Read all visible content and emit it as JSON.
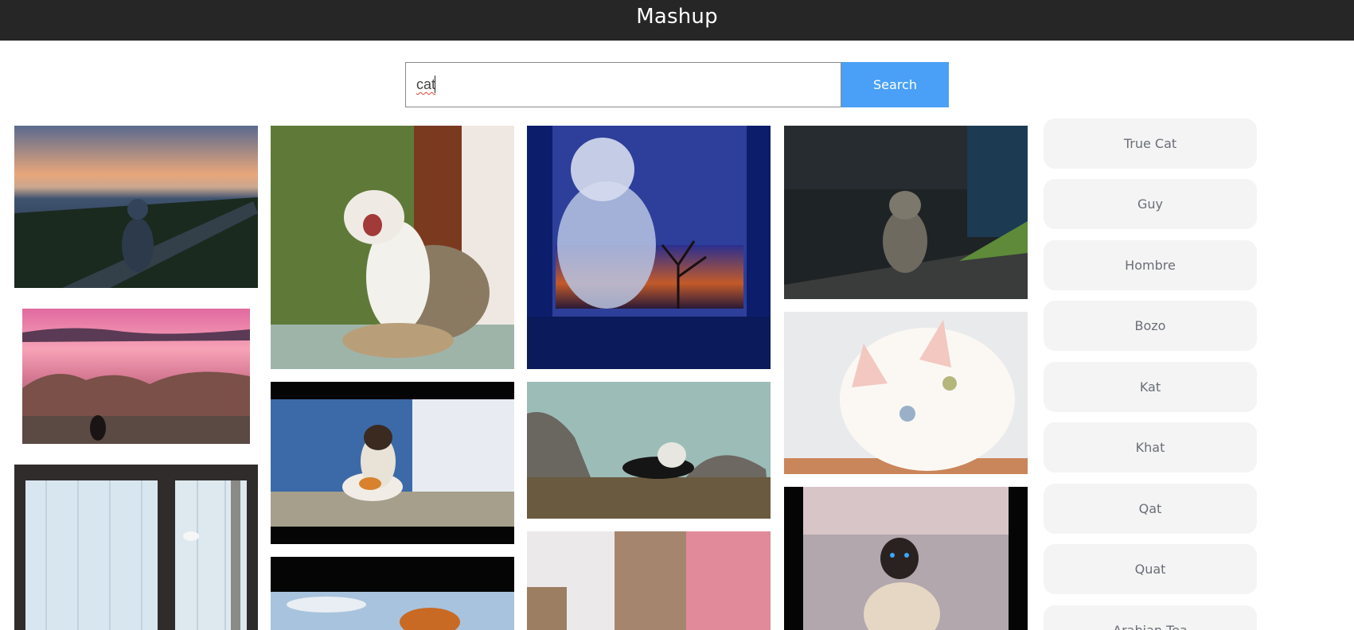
{
  "header": {
    "title": "Mashup"
  },
  "search": {
    "value": "cat",
    "button_label": "Search"
  },
  "photos": [
    {
      "name": "photo-cat-dusk-seaside"
    },
    {
      "name": "photo-cat-pink-sunset-rocks"
    },
    {
      "name": "photo-cat-window-curtains"
    },
    {
      "name": "photo-cat-yawning"
    },
    {
      "name": "photo-calico-cat-lying"
    },
    {
      "name": "photo-orange-foliage"
    },
    {
      "name": "photo-cat-window-reflection"
    },
    {
      "name": "photo-cat-on-rocks"
    },
    {
      "name": "photo-street-blur"
    },
    {
      "name": "photo-tabby-cat-sitting"
    },
    {
      "name": "photo-white-cat-closeup"
    },
    {
      "name": "photo-siamese-cat"
    }
  ],
  "sidebar": {
    "items": [
      {
        "label": "True Cat"
      },
      {
        "label": "Guy"
      },
      {
        "label": "Hombre"
      },
      {
        "label": "Bozo"
      },
      {
        "label": "Kat"
      },
      {
        "label": "Khat"
      },
      {
        "label": "Qat"
      },
      {
        "label": "Quat"
      },
      {
        "label": "Arabian Tea"
      }
    ]
  },
  "colors": {
    "header_bg": "#262626",
    "search_button": "#4aa0f7",
    "side_button_bg": "#f4f4f4"
  }
}
